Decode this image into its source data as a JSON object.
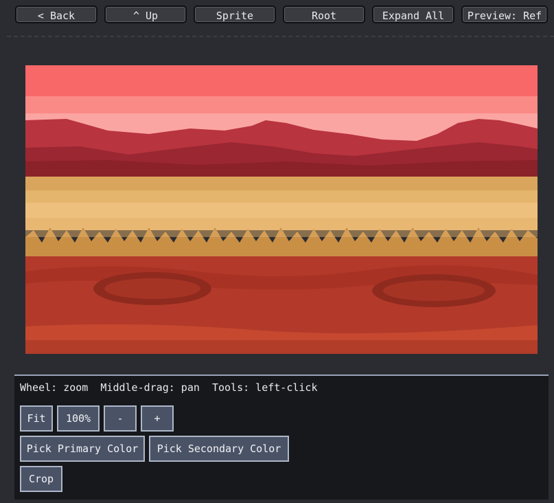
{
  "toolbar": {
    "back": "< Back",
    "up": "^ Up",
    "sprite": "Sprite",
    "root": "Root",
    "expand_all": "Expand All",
    "preview": "Preview: Ref"
  },
  "panel": {
    "hint": "Wheel: zoom  Middle-drag: pan  Tools: left-click",
    "fit": "Fit",
    "zoom100": "100%",
    "zoom_out": "-",
    "zoom_in": "+",
    "pick_primary": "Pick Primary Color",
    "pick_secondary": "Pick Secondary Color",
    "crop": "Crop"
  },
  "colors": {
    "sky_top": "#f86868",
    "sky_band": "#fa8a86",
    "sky_light": "#fba5a2",
    "mountain": "#b8343f",
    "mountain_dark": "#8b2129",
    "sand_dark": "#d9a45c",
    "sand_light": "#eec07d",
    "sand_spikes": "#c98f45",
    "ground": "#b33a2a",
    "ground_dark": "#8f2a1f",
    "ground_light": "#c6482f"
  }
}
